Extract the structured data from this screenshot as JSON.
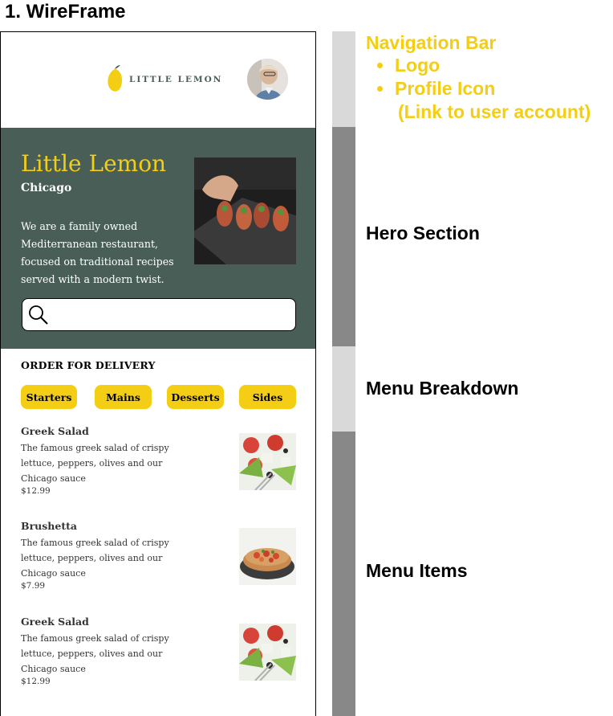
{
  "page": {
    "title": "1. WireFrame"
  },
  "navbar": {
    "logo_text": "LITTLE LEMON"
  },
  "hero": {
    "title": "Little Lemon",
    "city": "Chicago",
    "description": "We are a family owned Mediterranean restaurant, focused on traditional recipes served with a modern twist.",
    "search_placeholder": ""
  },
  "order": {
    "title": "ORDER FOR DELIVERY",
    "categories": [
      "Starters",
      "Mains",
      "Desserts",
      "Sides"
    ]
  },
  "menu_items": [
    {
      "name": "Greek Salad",
      "description": "The famous greek salad of crispy lettuce, peppers, olives and our Chicago sauce",
      "price": "$12.99"
    },
    {
      "name": "Brushetta",
      "description": "The famous greek salad of crispy lettuce, peppers, olives and our Chicago sauce",
      "price": "$7.99"
    },
    {
      "name": "Greek Salad",
      "description": "The famous greek salad of crispy lettuce, peppers, olives and our Chicago sauce",
      "price": "$12.99"
    }
  ],
  "annotations": {
    "navigation": "Navigation Bar",
    "nav_points": [
      "Logo",
      "Profile Icon"
    ],
    "nav_sub": "(Link to user account)",
    "hero": "Hero Section",
    "menu_breakdown": "Menu Breakdown",
    "menu_items": "Menu Items"
  },
  "colors": {
    "primary_green": "#495e57",
    "primary_yellow": "#f4ce14",
    "band_light": "#d9d9d9",
    "band_dark": "#888888"
  },
  "icons": {
    "search": "search-icon",
    "logo": "lemon-logo-icon",
    "avatar": "profile-icon"
  }
}
